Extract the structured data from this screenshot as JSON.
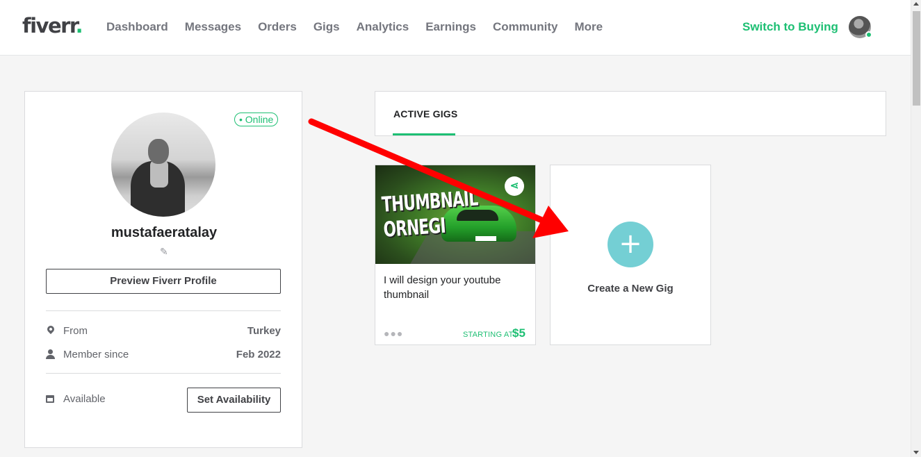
{
  "header": {
    "logo": "fiverr",
    "logo_dot": ".",
    "nav": [
      "Dashboard",
      "Messages",
      "Orders",
      "Gigs",
      "Analytics",
      "Earnings",
      "Community",
      "More"
    ],
    "switch_label": "Switch to Buying"
  },
  "profile": {
    "status": "• Online",
    "username": "mustafaeratalay",
    "preview_button": "Preview Fiverr Profile",
    "from_label": "From",
    "from_value": "Turkey",
    "member_label": "Member since",
    "member_value": "Feb 2022",
    "available_label": "Available",
    "availability_button": "Set Availability"
  },
  "tabs": {
    "active": "ACTIVE GIGS"
  },
  "gig": {
    "image_text_1": "THUMBNAIL",
    "image_text_2": "ORNEGI",
    "title": "I will design your youtube thumbnail",
    "dots": "●●●",
    "starting_label": "STARTING AT",
    "price": "$5"
  },
  "create_gig": {
    "plus": "+",
    "label": "Create a New Gig"
  },
  "colors": {
    "brand_green": "#1dbf73",
    "create_teal": "#74cfd4",
    "annotation_red": "#ff0000"
  }
}
